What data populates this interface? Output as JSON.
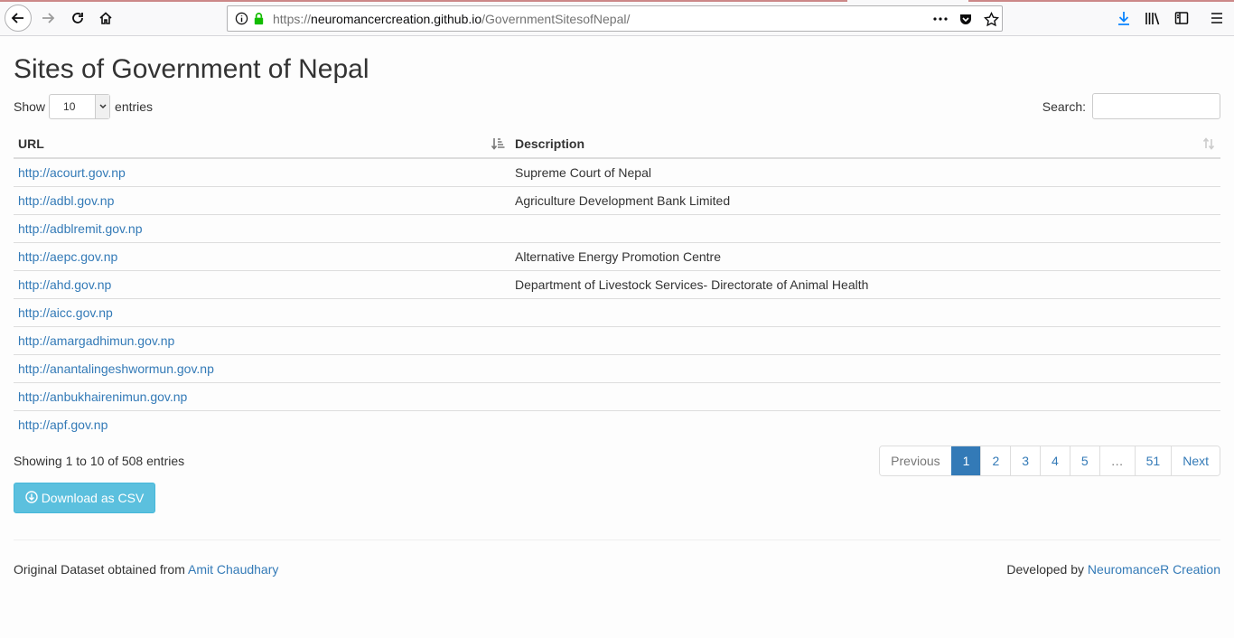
{
  "browser": {
    "url_protocol": "https://",
    "url_domain": "neuromancercreation.github.io",
    "url_path": "/GovernmentSitesofNepal/",
    "icons": [
      "back-icon",
      "forward-icon",
      "reload-icon",
      "home-icon",
      "info-icon",
      "lock-icon",
      "more-icon",
      "pocket-icon",
      "star-icon",
      "download-icon",
      "library-icon",
      "sidebar-icon",
      "menu-icon"
    ]
  },
  "page": {
    "title": "Sites of Government of Nepal",
    "show_label": "Show",
    "entries_label": "entries",
    "page_length": "10",
    "search_label": "Search:",
    "search_value": ""
  },
  "table": {
    "columns": [
      "URL",
      "Description"
    ],
    "rows": [
      {
        "url": "http://acourt.gov.np",
        "description": "Supreme Court of Nepal"
      },
      {
        "url": "http://adbl.gov.np",
        "description": "Agriculture Development Bank Limited"
      },
      {
        "url": "http://adblremit.gov.np",
        "description": ""
      },
      {
        "url": "http://aepc.gov.np",
        "description": "Alternative Energy Promotion Centre"
      },
      {
        "url": "http://ahd.gov.np",
        "description": "Department of Livestock Services- Directorate of Animal Health"
      },
      {
        "url": "http://aicc.gov.np",
        "description": ""
      },
      {
        "url": "http://amargadhimun.gov.np",
        "description": ""
      },
      {
        "url": "http://anantalingeshwormun.gov.np",
        "description": ""
      },
      {
        "url": "http://anbukhairenimun.gov.np",
        "description": ""
      },
      {
        "url": "http://apf.gov.np",
        "description": ""
      }
    ]
  },
  "info": "Showing 1 to 10 of 508 entries",
  "pagination": {
    "previous": "Previous",
    "pages": [
      "1",
      "2",
      "3",
      "4",
      "5",
      "…",
      "51"
    ],
    "next": "Next",
    "active": "1"
  },
  "download_button": "Download as CSV",
  "footer": {
    "left_text": "Original Dataset obtained from",
    "left_link": "Amit Chaudhary",
    "right_text": "Developed by",
    "right_link": "NeuromanceR Creation"
  },
  "colors": {
    "link": "#337ab7",
    "active_page": "#337ab7",
    "csv_button": "#5bc0de"
  }
}
